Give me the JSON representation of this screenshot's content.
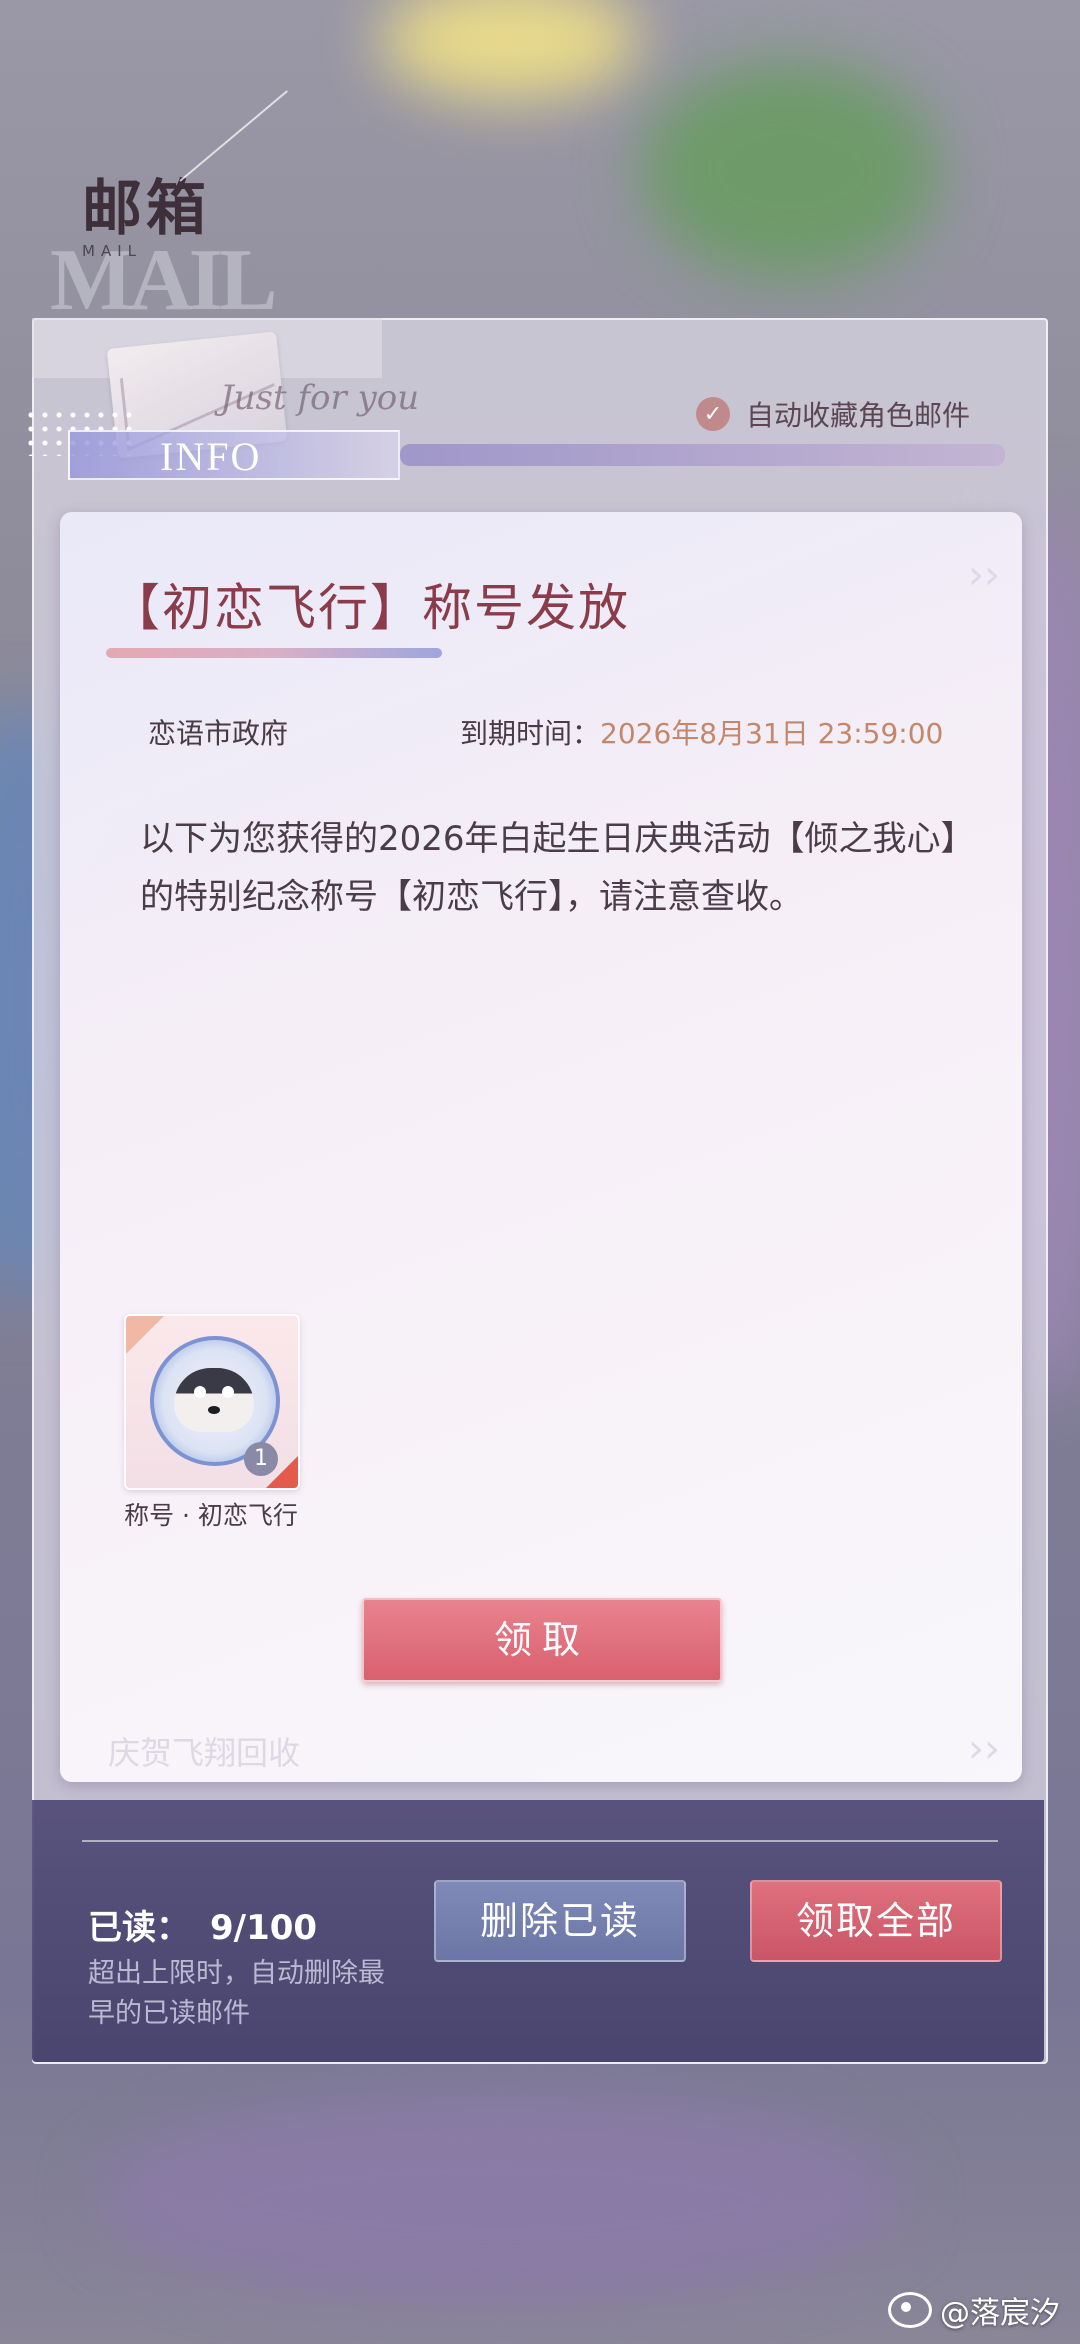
{
  "header": {
    "title": "邮箱",
    "subtitle": "MAIL",
    "decorative_big": "MAIL"
  },
  "panel": {
    "just_for_you": "Just for you",
    "info_label": "INFO",
    "auto_collect_label": "自动收藏角色邮件",
    "auto_collect_checked": true
  },
  "mail": {
    "title": "【初恋飞行】称号发放",
    "sender": "恋语市政府",
    "expire_label": "到期时间：",
    "expire_value": "2026年8月31日 23:59:00",
    "body": "以下为您获得的2026年白起生日庆典活动【倾之我心】的特别纪念称号【初恋飞行】，请注意查收。",
    "attachment": {
      "name": "称号 · 初恋飞行",
      "quantity": "1"
    },
    "claim_button": "领取",
    "faded_footer": "庆贺飞翔回收"
  },
  "footer": {
    "read_label": "已读：",
    "read_count": "9/100",
    "hint": "超出上限时，自动删除最早的已读邮件",
    "delete_read_button": "删除已读",
    "claim_all_button": "领取全部"
  },
  "watermark": {
    "text": "@落宸汐"
  },
  "colors": {
    "accent_pink": "#d9606f",
    "accent_blue": "#6c76a6",
    "title_color": "#8a3c4a",
    "expire_color": "#c5876a"
  }
}
